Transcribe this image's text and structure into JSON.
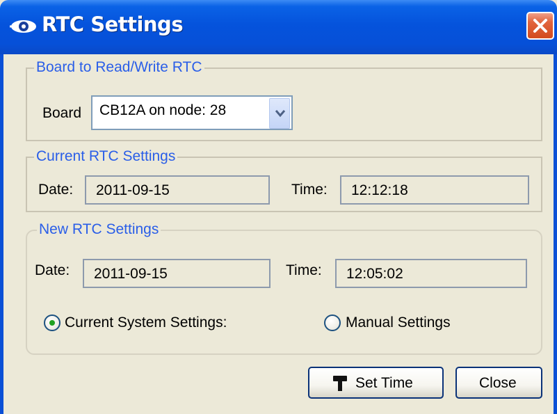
{
  "window": {
    "title": "RTC Settings",
    "close_icon": "close-icon",
    "app_icon": "eye-logo-icon"
  },
  "board_group": {
    "legend": "Board to Read/Write RTC",
    "board_label": "Board",
    "board_selected": "CB12A on node: 28"
  },
  "current_group": {
    "legend": "Current RTC Settings",
    "date_label": "Date:",
    "date_value": "2011-09-15",
    "time_label": "Time:",
    "time_value": "12:12:18"
  },
  "new_group": {
    "legend": "New RTC Settings",
    "date_label": "Date:",
    "date_value": "2011-09-15",
    "time_label": "Time:",
    "time_value": "12:05:02",
    "radio_system_label": "Current System Settings:",
    "radio_manual_label": "Manual Settings",
    "selected_option": "Current System Settings:"
  },
  "buttons": {
    "set_time": "Set Time",
    "close": "Close"
  },
  "colors": {
    "title_bar": "#0553dc",
    "legend_text": "#2a5ee8",
    "dialog_bg": "#ece9d8",
    "radio_selected": "#21a121"
  }
}
